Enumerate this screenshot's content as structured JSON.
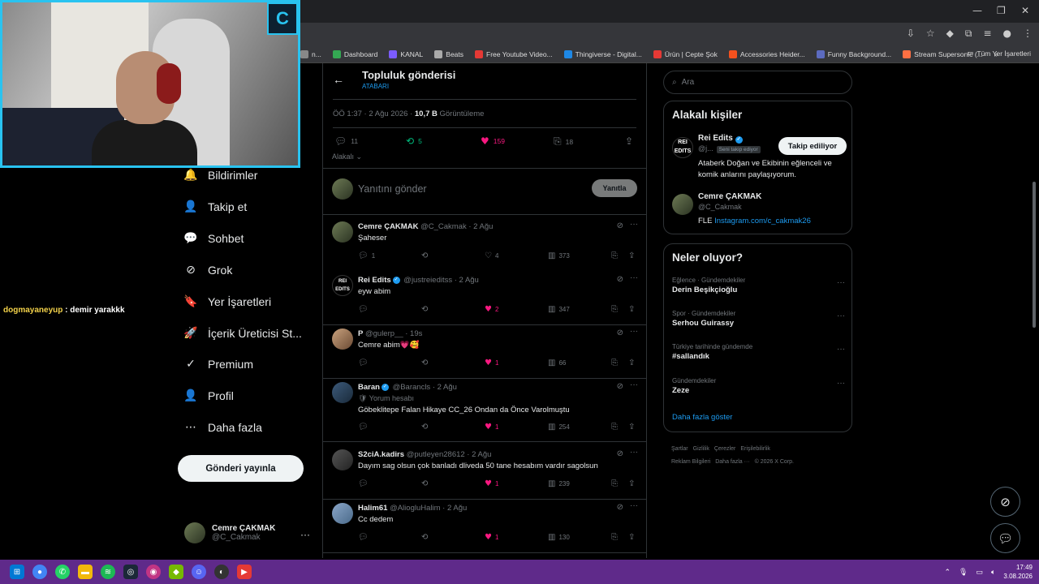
{
  "browser": {
    "window_controls": [
      "—",
      "❐",
      "✕"
    ],
    "bookmarks": [
      {
        "label": "n...",
        "color": "#888888"
      },
      {
        "label": "Dashboard",
        "color": "#34a853"
      },
      {
        "label": "KANAL",
        "color": "#7b5cff"
      },
      {
        "label": "Beats",
        "color": "#aaaaaa"
      },
      {
        "label": "Free Youtube Video...",
        "color": "#e53935"
      },
      {
        "label": "Thingiverse - Digital...",
        "color": "#1e88e5"
      },
      {
        "label": "Ürün | Cepte Şok",
        "color": "#e53935"
      },
      {
        "label": "Accessories Heider...",
        "color": "#f4511e"
      },
      {
        "label": "Funny Background...",
        "color": "#5c6bc0"
      },
      {
        "label": "Stream Supersonic (...",
        "color": "#ff7043"
      }
    ],
    "bookmarks_overflow": "»",
    "all_bookmarks": "Tüm Yer İşaretleri"
  },
  "chat": {
    "user": "dogmayaneyup",
    "message": " : demir yarakkk"
  },
  "nav": {
    "items": [
      {
        "label": "Bildirimler",
        "icon": "🔔"
      },
      {
        "label": "Takip et",
        "icon": "👤"
      },
      {
        "label": "Sohbet",
        "icon": "💬"
      },
      {
        "label": "Grok",
        "icon": "⊘"
      },
      {
        "label": "Yer İşaretleri",
        "icon": "🔖"
      },
      {
        "label": "İçerik Üreticisi St...",
        "icon": "🚀"
      },
      {
        "label": "Premium",
        "icon": "✓"
      },
      {
        "label": "Profil",
        "icon": "👤"
      },
      {
        "label": "Daha fazla",
        "icon": "⋯"
      }
    ],
    "post_button": "Gönderi yayınla",
    "account": {
      "name": "Cemre ÇAKMAK",
      "handle": "@C_Cakmak",
      "more": "···"
    }
  },
  "main": {
    "back": "←",
    "title": "Topluluk gönderisi",
    "subtitle": "ATABARI",
    "meta_time": "ÖÖ 1:37 · 2 Ağu 2026 · ",
    "meta_views": "10,7 B",
    "meta_views_label": " Görüntüleme",
    "stats": {
      "replies": "11",
      "reposts": "5",
      "likes": "159",
      "bookmarks": "18"
    },
    "relevant": "Alakalı",
    "reply_placeholder": "Yanıtını gönder",
    "reply_button": "Yanıtla",
    "replies": [
      {
        "name": "Cemre ÇAKMAK",
        "verified": false,
        "handle": "@C_Cakmak · 2 Ağu",
        "text": "Şaheser",
        "sub": "",
        "comments": "1",
        "reposts": "",
        "likes": "4",
        "liked": false,
        "views": "373"
      },
      {
        "name": "Rei Edits",
        "verified": true,
        "handle": "@justreieditss · 2 Ağu",
        "text": "eyw abim",
        "sub": "",
        "comments": "",
        "reposts": "",
        "likes": "2",
        "liked": true,
        "views": "347"
      },
      {
        "name": "P",
        "verified": false,
        "handle": "@gulerp__ · 19s",
        "text": "Cemre abim💗🥰",
        "sub": "",
        "comments": "",
        "reposts": "",
        "likes": "1",
        "liked": true,
        "views": "66"
      },
      {
        "name": "Baran",
        "verified": true,
        "handle": "@Barancls · 2 Ağu",
        "text": "Göbeklitepe Falan Hikaye CC_26 Ondan da Önce Varolmuştu",
        "sub": "Yorum hesabı",
        "comments": "",
        "reposts": "",
        "likes": "1",
        "liked": true,
        "views": "254"
      },
      {
        "name": "S2ciA.kadirs",
        "verified": false,
        "handle": "@putleyen28612 · 2 Ağu",
        "text": "Dayım sag olsun çok banladı dliveda 50 tane hesabım vardır sagolsun",
        "sub": "",
        "comments": "",
        "reposts": "",
        "likes": "1",
        "liked": true,
        "views": "239"
      },
      {
        "name": "Halim61",
        "verified": false,
        "handle": "@AliogluHalim · 2 Ağu",
        "text": "Cc dedem",
        "sub": "",
        "comments": "",
        "reposts": "",
        "likes": "1",
        "liked": true,
        "views": "130"
      }
    ]
  },
  "right": {
    "search_placeholder": "Ara",
    "related_title": "Alakalı kişiler",
    "related": [
      {
        "name": "Rei Edits",
        "handle": "@j...",
        "follows_you": "Seni takip ediyor",
        "button": "Takip ediliyor",
        "bio_line1": "Ataberk Doğan ve Ekibinin eğlenceli ve",
        "bio_line2": "komik anlarını paylaşıyorum."
      },
      {
        "name": "Cemre ÇAKMAK",
        "handle": "@C_Cakmak",
        "bio_prefix": "FLE ",
        "bio_link": "Instagram.com/c_cakmak26"
      }
    ],
    "trends_title": "Neler oluyor?",
    "trends": [
      {
        "category": "Eğlence · Gündemdekiler",
        "title": "Derin Beşikçioğlu"
      },
      {
        "category": "Spor · Gündemdekiler",
        "title": "Serhou Guirassy"
      },
      {
        "category": "Türkiye tarihinde gündemde",
        "title": "#sallandık"
      },
      {
        "category": "Gündemdekiler",
        "title": "Zeze"
      }
    ],
    "show_more": "Daha fazla göster",
    "footer_line1": [
      "Şartlar",
      "Gizlilik",
      "Çerezler",
      "Erişilebilirlik"
    ],
    "footer_line2": [
      "Reklam Bilgileri",
      "Daha fazla ···",
      "© 2026 X Corp."
    ]
  },
  "taskbar": {
    "time": "17:49",
    "date": "3.08.2026"
  }
}
